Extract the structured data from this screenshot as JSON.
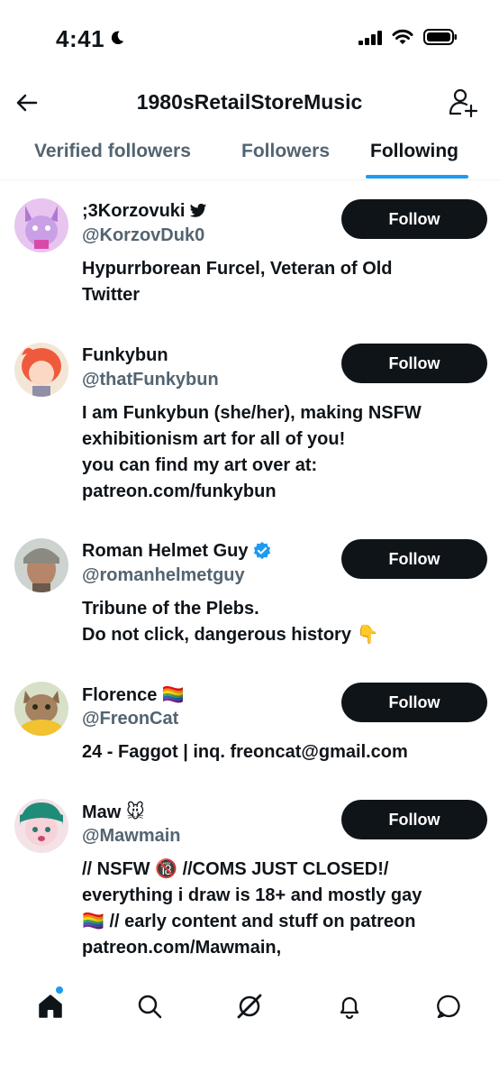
{
  "status_bar": {
    "time": "4:41"
  },
  "header": {
    "title": "1980sRetailStoreMusic"
  },
  "tabs": [
    {
      "label": "Verified followers"
    },
    {
      "label": "Followers"
    },
    {
      "label": "Following"
    }
  ],
  "active_tab": "Following",
  "users": [
    {
      "name": ";3Korzovuki",
      "handle": "@KorzovDuk0",
      "bio": [
        "Hypurrborean Furcel, Veteran of Old",
        "Twitter"
      ],
      "follow_label": "Follow"
    },
    {
      "name": "Funkybun",
      "handle": "@thatFunkybun",
      "bio": [
        "I am Funkybun (she/her), making NSFW",
        "exhibitionism art for all of you!",
        "you can find my art over at:",
        "patreon.com/funkybun"
      ],
      "follow_label": "Follow"
    },
    {
      "name": "Roman Helmet Guy",
      "handle": "@romanhelmetguy",
      "bio": [
        "Tribune of the Plebs.",
        "Do not click, dangerous history 👇"
      ],
      "follow_label": "Follow"
    },
    {
      "name": "Florence 🏳️‍🌈",
      "handle": "@FreonCat",
      "bio": [
        "24 - Faggot | inq. freoncat@gmail.com"
      ],
      "follow_label": "Follow"
    },
    {
      "name": "Maw 🐭",
      "handle": "@Mawmain",
      "bio": [
        "// NSFW 🔞 //COMS JUST CLOSED!/",
        "everything i draw is 18+ and mostly gay",
        "🏳️‍🌈 // early content and stuff on patreon",
        "patreon.com/Mawmain,"
      ],
      "follow_label": "Follow"
    }
  ],
  "icons": {
    "back": "arrow-left-icon",
    "add_user": "add-user-icon",
    "nav": [
      "home-icon",
      "search-icon",
      "grok-icon",
      "bell-icon",
      "message-icon"
    ]
  },
  "colors": {
    "accent": "#1d9bf0",
    "text": "#0f1419",
    "secondary": "#536471",
    "button": "#0f1419"
  }
}
